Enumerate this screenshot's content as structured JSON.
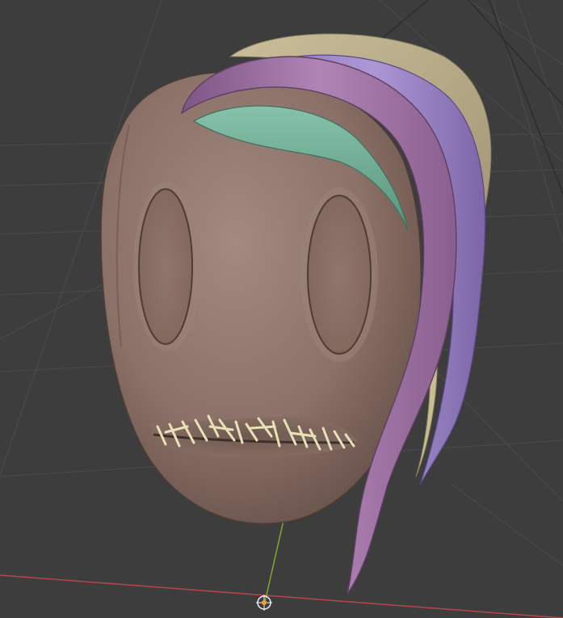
{
  "scene": {
    "kind": "3d-viewport-sculpt",
    "subject": "stitched-mouth-head-with-hair",
    "colors": {
      "background": "#3d3d3d",
      "grid_line": "#4a4a4a",
      "x_axis": "#b8454b",
      "y_axis": "#7fa82c",
      "skin": "#8b7167",
      "skin_highlight": "#a08880",
      "skin_shadow": "#5f4a43",
      "hair_purple": "#9a6c9a",
      "hair_purple_light": "#b58ab8",
      "hair_violet": "#9d86c7",
      "hair_teal": "#6eaa92",
      "hair_tan": "#b8ab86",
      "stitches": "#e6e2b6",
      "origin_marker": "#f0a040"
    },
    "objects": [
      {
        "name": "head",
        "icon": "head-mesh"
      },
      {
        "name": "left-eye-socket",
        "icon": "eye-recess"
      },
      {
        "name": "right-eye-socket",
        "icon": "eye-recess"
      },
      {
        "name": "stitched-mouth",
        "icon": "stitches"
      },
      {
        "name": "hair-strands",
        "icon": "hair"
      },
      {
        "name": "object-origin",
        "icon": "origin-crosshair"
      }
    ]
  }
}
